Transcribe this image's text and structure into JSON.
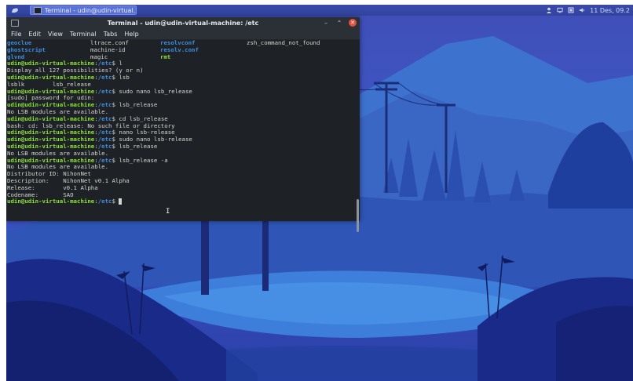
{
  "panel": {
    "task_label": "Terminal - udin@udin-virtual...",
    "clock": "11 Des, 09.2"
  },
  "terminal": {
    "title": "Terminal - udin@udin-virtual-machine: /etc",
    "menu": [
      "File",
      "Edit",
      "View",
      "Terminal",
      "Tabs",
      "Help"
    ],
    "ls_rows": [
      [
        {
          "text": "geoclue",
          "style": "dir"
        },
        {
          "text": "ltrace.conf",
          "style": "plain"
        },
        {
          "text": "resolvconf",
          "style": "dir"
        },
        {
          "text": "zsh_command_not_found",
          "style": "plain"
        }
      ],
      [
        {
          "text": "ghostscript",
          "style": "dir"
        },
        {
          "text": "machine-id",
          "style": "plain"
        },
        {
          "text": "resolv.conf",
          "style": "dir"
        },
        {
          "text": "",
          "style": "plain"
        }
      ],
      [
        {
          "text": "glvnd",
          "style": "dir"
        },
        {
          "text": "magic",
          "style": "plain"
        },
        {
          "text": "rmt",
          "style": "exe"
        },
        {
          "text": "",
          "style": "plain"
        }
      ]
    ],
    "lines": [
      {
        "prompt": "udin@udin-virtual-machine",
        "path": "/etc",
        "cmd": " l"
      },
      {
        "text": "Display all 127 possibilities? (y or n)"
      },
      {
        "prompt": "udin@udin-virtual-machine",
        "path": "/etc",
        "cmd": " lsb"
      },
      {
        "text": "lsblk        lsb_release"
      },
      {
        "prompt": "udin@udin-virtual-machine",
        "path": "/etc",
        "cmd": " sudo nano lsb_release"
      },
      {
        "text": "[sudo] password for udin:"
      },
      {
        "prompt": "udin@udin-virtual-machine",
        "path": "/etc",
        "cmd": " lsb_release"
      },
      {
        "text": "No LSB modules are available."
      },
      {
        "prompt": "udin@udin-virtual-machine",
        "path": "/etc",
        "cmd": " cd lsb_release"
      },
      {
        "text": "bash: cd: lsb_release: No such file or directory"
      },
      {
        "prompt": "udin@udin-virtual-machine",
        "path": "/etc",
        "cmd": " nano lsb-release"
      },
      {
        "prompt": "udin@udin-virtual-machine",
        "path": "/etc",
        "cmd": " sudo nano lsb-release"
      },
      {
        "prompt": "udin@udin-virtual-machine",
        "path": "/etc",
        "cmd": " lsb_release"
      },
      {
        "text": "No LSB modules are available."
      },
      {
        "prompt": "udin@udin-virtual-machine",
        "path": "/etc",
        "cmd": " lsb_release -a"
      },
      {
        "text": "No LSB modules are available."
      },
      {
        "text": "Distributor ID: NihonNet"
      },
      {
        "text": "Description:    NihonNet v0.1 Alpha"
      },
      {
        "text": "Release:        v0.1 Alpha"
      },
      {
        "text": "Codename:       SAO"
      },
      {
        "prompt": "udin@udin-virtual-machine",
        "path": "/etc",
        "cmd": " ",
        "cursor": true
      }
    ]
  },
  "colors": {
    "user_prompt": "#8ae234",
    "path": "#3d8ee0",
    "terminal_bg": "#1e2227",
    "close_button": "#e0503f"
  }
}
